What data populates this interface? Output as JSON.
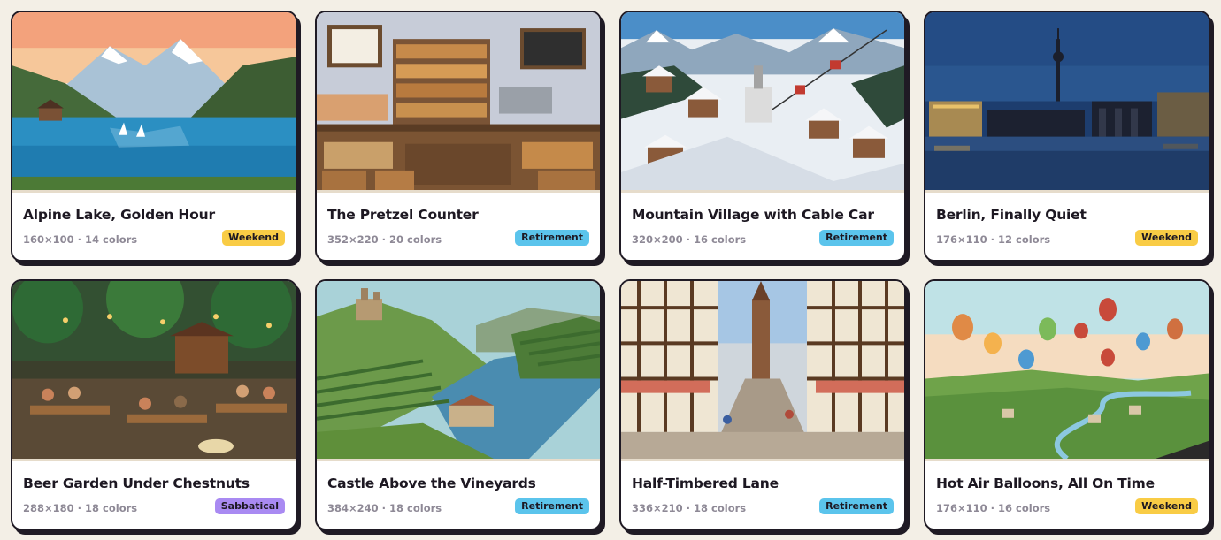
{
  "colors": {
    "weekend": "#f9cc45",
    "retirement": "#5bc4ec",
    "sabbatical": "#a98af2"
  },
  "cards": [
    {
      "title": "Alpine Lake, Golden Hour",
      "meta": "160×100 · 14 colors",
      "badge": "Weekend",
      "scene": "alpine-lake"
    },
    {
      "title": "The Pretzel Counter",
      "meta": "352×220 · 20 colors",
      "badge": "Retirement",
      "scene": "bakery"
    },
    {
      "title": "Mountain Village with Cable Car",
      "meta": "320×200 · 16 colors",
      "badge": "Retirement",
      "scene": "snow-village"
    },
    {
      "title": "Berlin, Finally Quiet",
      "meta": "176×110 · 12 colors",
      "badge": "Weekend",
      "scene": "berlin-night"
    },
    {
      "title": "Beer Garden Under Chestnuts",
      "meta": "288×180 · 18 colors",
      "badge": "Sabbatical",
      "scene": "beer-garden"
    },
    {
      "title": "Castle Above the Vineyards",
      "meta": "384×240 · 18 colors",
      "badge": "Retirement",
      "scene": "castle-vineyard"
    },
    {
      "title": "Half-Timbered Lane",
      "meta": "336×210 · 18 colors",
      "badge": "Retirement",
      "scene": "timbered-lane"
    },
    {
      "title": "Hot Air Balloons, All On Time",
      "meta": "176×110 · 16 colors",
      "badge": "Weekend",
      "scene": "balloons"
    }
  ]
}
